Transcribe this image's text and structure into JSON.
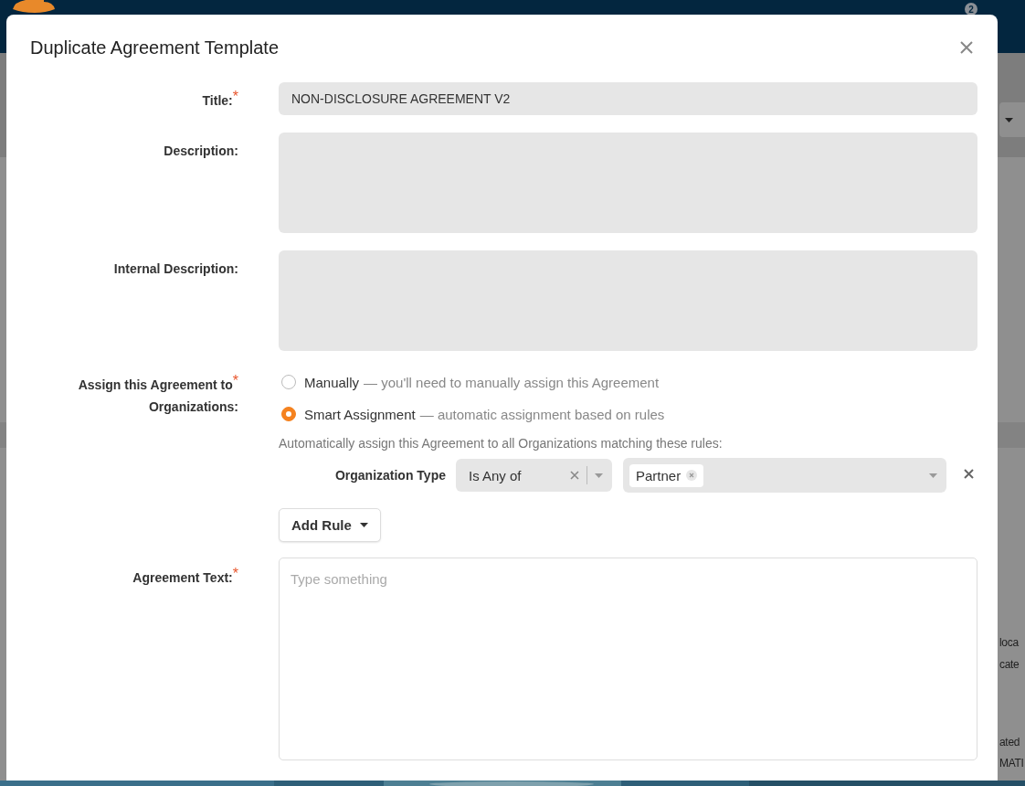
{
  "background": {
    "notification_count": "2",
    "text_fragments": [
      "loca",
      "cate",
      "ated",
      "MATI"
    ]
  },
  "dialog": {
    "title": "Duplicate Agreement Template",
    "fields": [
      {
        "kind": "text",
        "label": "Title:$^{*}$",
        "value": "NON-DISCLOSURE AGREEMENT V2"
      },
      {
        "kind": "textarea",
        "label": "Description:"
      },
      {
        "kind": "textarea",
        "label": "Internal Description:"
      }
    ],
    "assignment": {
      "label": "Assign this Agreement to$^{*}$ Organizations:",
      "options": [
        {
          "label": "Manually",
          "hint": "— you'll need to manually assign this Agreement",
          "selected": false
        },
        {
          "label": "Smart Assignment",
          "hint": "— automatic assignment based on rules",
          "selected": true
        }
      ],
      "rules_intro": "Automatically assign this Agreement to all Organizations matching these rules:",
      "rules": [
        {
          "field": "Organization Type",
          "operator": "Is Any of",
          "values": [
            "Partner"
          ]
        }
      ],
      "add_rule_button": "Add Rule"
    },
    "agreement_text": {
      "label": "Agreement Text:$^{*}$",
      "placeholder": "Type something"
    }
  }
}
